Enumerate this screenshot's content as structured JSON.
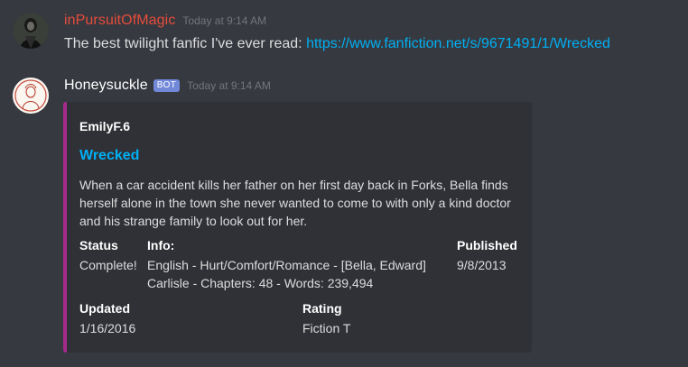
{
  "colors": {
    "background": "#36393f",
    "embed_background": "#2f3136",
    "embed_accent": "#a62a8c",
    "link": "#00b0f4",
    "user1_name": "#e74c3c",
    "user2_name": "#ffffff",
    "bot_tag": "#7289da",
    "timestamp": "#72767d",
    "text": "#dcddde"
  },
  "messages": [
    {
      "username": "inPursuitOfMagic",
      "avatar_icon": "user-avatar-icon",
      "timestamp": "Today at 9:14 AM",
      "text": "The best twilight fanfic I've ever read: ",
      "link": "https://www.fanfiction.net/s/9671491/1/Wrecked"
    },
    {
      "username": "Honeysuckle",
      "bot_tag": "BOT",
      "avatar_icon": "bot-avatar-icon",
      "timestamp": "Today at 9:14 AM",
      "embed": {
        "author": "EmilyF.6",
        "title": "Wrecked",
        "description": "When a car accident kills her father on her first day back in Forks, Bella finds herself alone in the town she never wanted to come to with only a kind doctor and his strange family to look out for her.",
        "fields": [
          {
            "name": "Status",
            "value": "Complete!"
          },
          {
            "name": "Info:",
            "value": "English - Hurt/Comfort/Romance - [Bella, Edward] Carlisle - Chapters: 48 - Words: 239,494"
          },
          {
            "name": "Published",
            "value": "9/8/2013"
          },
          {
            "name": "Updated",
            "value": "1/16/2016"
          },
          {
            "name": "Rating",
            "value": "Fiction T"
          }
        ]
      }
    }
  ]
}
